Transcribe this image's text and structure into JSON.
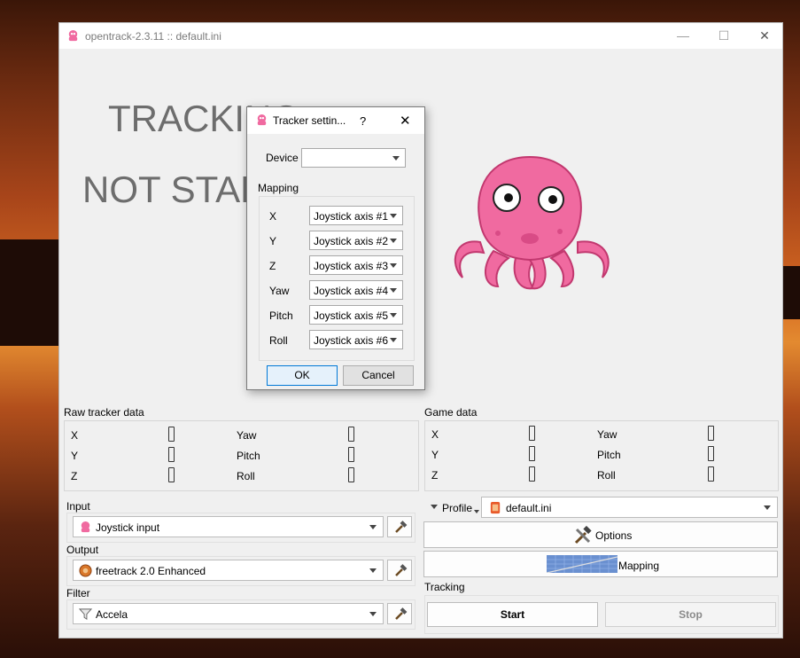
{
  "window": {
    "title": "opentrack-2.3.11 :: default.ini",
    "minimize": "—",
    "maximize": "☐",
    "close": "✕"
  },
  "status": {
    "line1": "TRACKING",
    "line2": "NOT STARTED"
  },
  "raw": {
    "title": "Raw tracker data",
    "x": "X",
    "y": "Y",
    "z": "Z",
    "yaw": "Yaw",
    "pitch": "Pitch",
    "roll": "Roll"
  },
  "game": {
    "title": "Game data",
    "x": "X",
    "y": "Y",
    "z": "Z",
    "yaw": "Yaw",
    "pitch": "Pitch",
    "roll": "Roll"
  },
  "modules": {
    "input_label": "Input",
    "input_value": "Joystick input",
    "output_label": "Output",
    "output_value": "freetrack 2.0 Enhanced",
    "filter_label": "Filter",
    "filter_value": "Accela"
  },
  "profile": {
    "label": "Profile",
    "value": "default.ini"
  },
  "buttons": {
    "options": "Options",
    "mapping": "Mapping"
  },
  "tracking": {
    "label": "Tracking",
    "start": "Start",
    "stop": "Stop"
  },
  "dialog": {
    "title": "Tracker settin...",
    "help": "?",
    "close": "✕",
    "device_label": "Device",
    "device_value": "",
    "mapping_label": "Mapping",
    "rows": [
      {
        "axis": "X",
        "value": "Joystick axis #1"
      },
      {
        "axis": "Y",
        "value": "Joystick axis #2"
      },
      {
        "axis": "Z",
        "value": "Joystick axis #3"
      },
      {
        "axis": "Yaw",
        "value": "Joystick axis #4"
      },
      {
        "axis": "Pitch",
        "value": "Joystick axis #5"
      },
      {
        "axis": "Roll",
        "value": "Joystick axis #6"
      }
    ],
    "ok": "OK",
    "cancel": "Cancel"
  },
  "colors": {
    "octopus": "#f06aa0",
    "accent": "#0078d7"
  }
}
